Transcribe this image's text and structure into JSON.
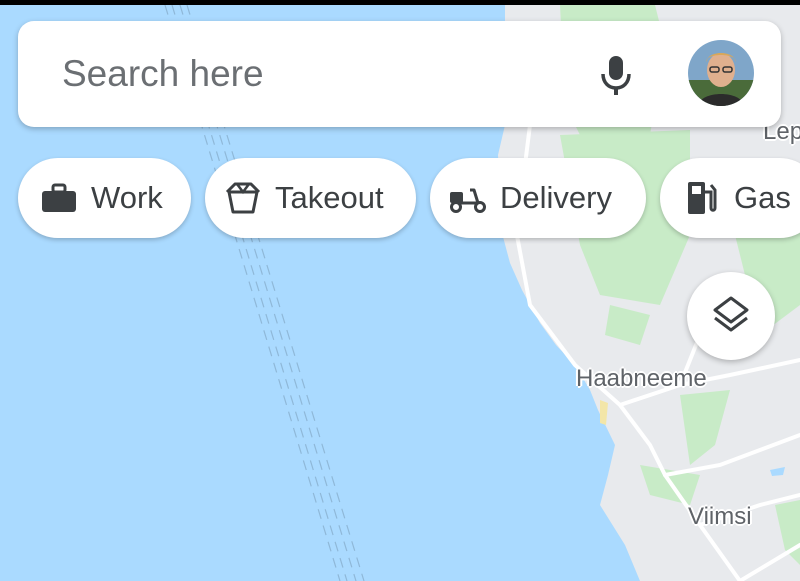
{
  "search": {
    "placeholder": "Search here",
    "mic_icon": "microphone-icon",
    "avatar": "user-avatar"
  },
  "chips": [
    {
      "label": "Work",
      "icon": "briefcase-icon"
    },
    {
      "label": "Takeout",
      "icon": "takeout-box-icon"
    },
    {
      "label": "Delivery",
      "icon": "scooter-icon"
    },
    {
      "label": "Gas",
      "icon": "gas-station-icon"
    }
  ],
  "layers_button": {
    "icon": "layers-icon"
  },
  "map": {
    "places": [
      "Haabneeme",
      "Viimsi",
      "Lep"
    ],
    "colors": {
      "water": "#aadaff",
      "land": "#e8eaed",
      "park": "#c8ebc7",
      "road": "#ffffff"
    }
  }
}
